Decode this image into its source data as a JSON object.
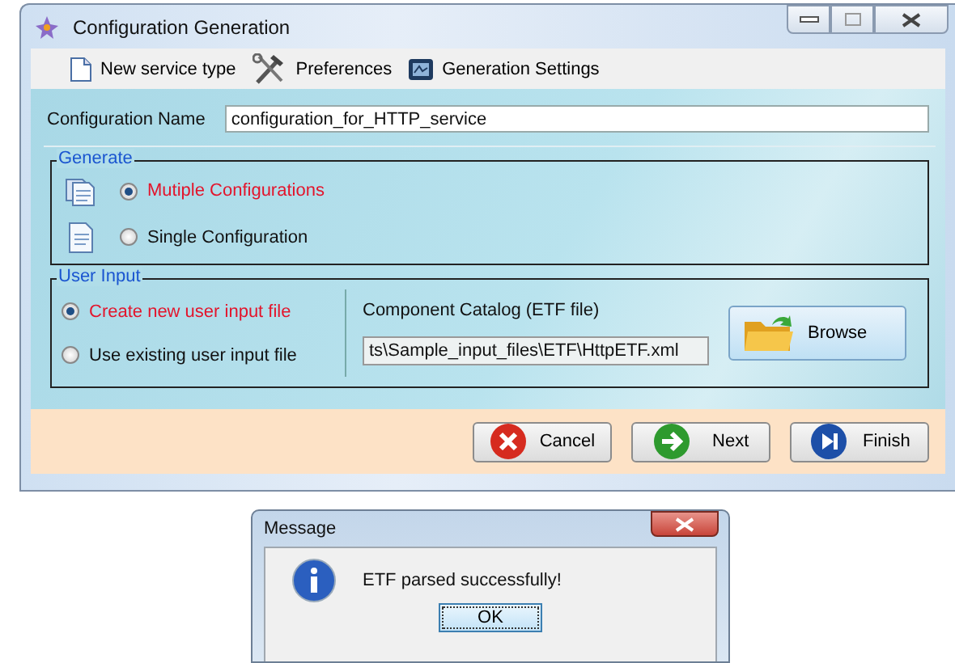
{
  "window": {
    "title": "Configuration Generation"
  },
  "toolbar": [
    {
      "label": "New service type"
    },
    {
      "label": "Preferences"
    },
    {
      "label": "Generation Settings"
    }
  ],
  "configuration_name": {
    "label": "Configuration Name",
    "value": "configuration_for_HTTP_service"
  },
  "generate": {
    "legend": "Generate",
    "options": [
      {
        "label": "Mutiple Configurations",
        "selected": true
      },
      {
        "label": "Single Configuration",
        "selected": false
      }
    ]
  },
  "user_input": {
    "legend": "User Input",
    "options": [
      {
        "label": "Create new user input file",
        "selected": true
      },
      {
        "label": "Use existing user input file",
        "selected": false
      }
    ],
    "catalog_label": "Component Catalog (ETF file)",
    "catalog_path": "ts\\Sample_input_files\\ETF\\HttpETF.xml",
    "browse": "Browse"
  },
  "buttons": [
    "Cancel",
    "Next",
    "Finish"
  ],
  "message": {
    "title": "Message",
    "text": "ETF parsed successfully!",
    "button": "OK"
  }
}
